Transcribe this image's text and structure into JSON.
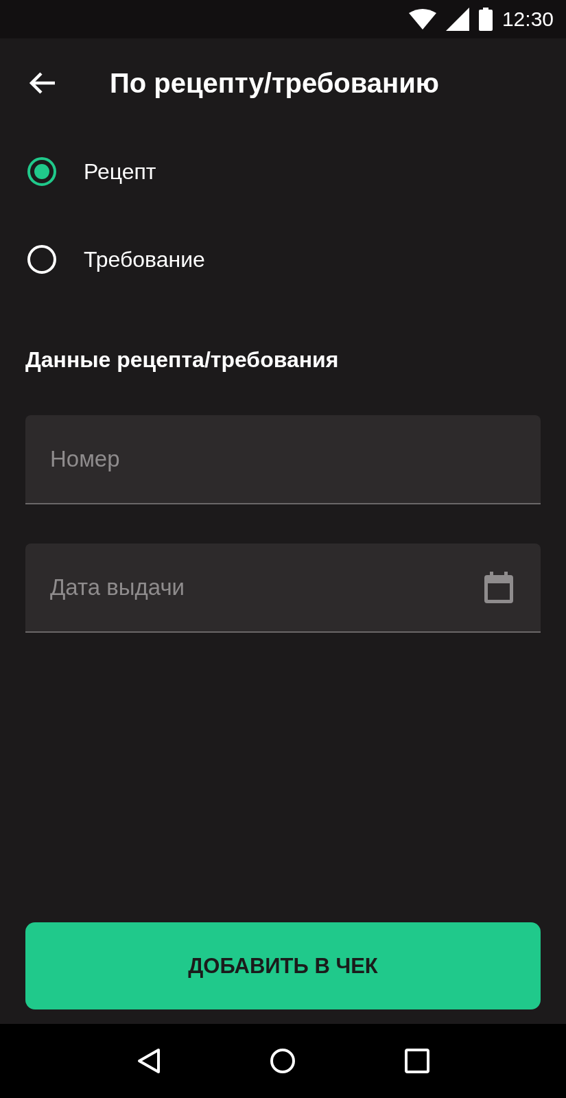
{
  "status_bar": {
    "time": "12:30"
  },
  "app_bar": {
    "title": "По рецепту/требованию"
  },
  "options": [
    {
      "label": "Рецепт",
      "selected": true
    },
    {
      "label": "Требование",
      "selected": false
    }
  ],
  "section_title": "Данные рецепта/требования",
  "fields": [
    {
      "kind": "text",
      "placeholder": "Номер"
    },
    {
      "kind": "date",
      "placeholder": "Дата выдачи"
    }
  ],
  "primary_button": "ДОБАВИТЬ В ЧЕК"
}
